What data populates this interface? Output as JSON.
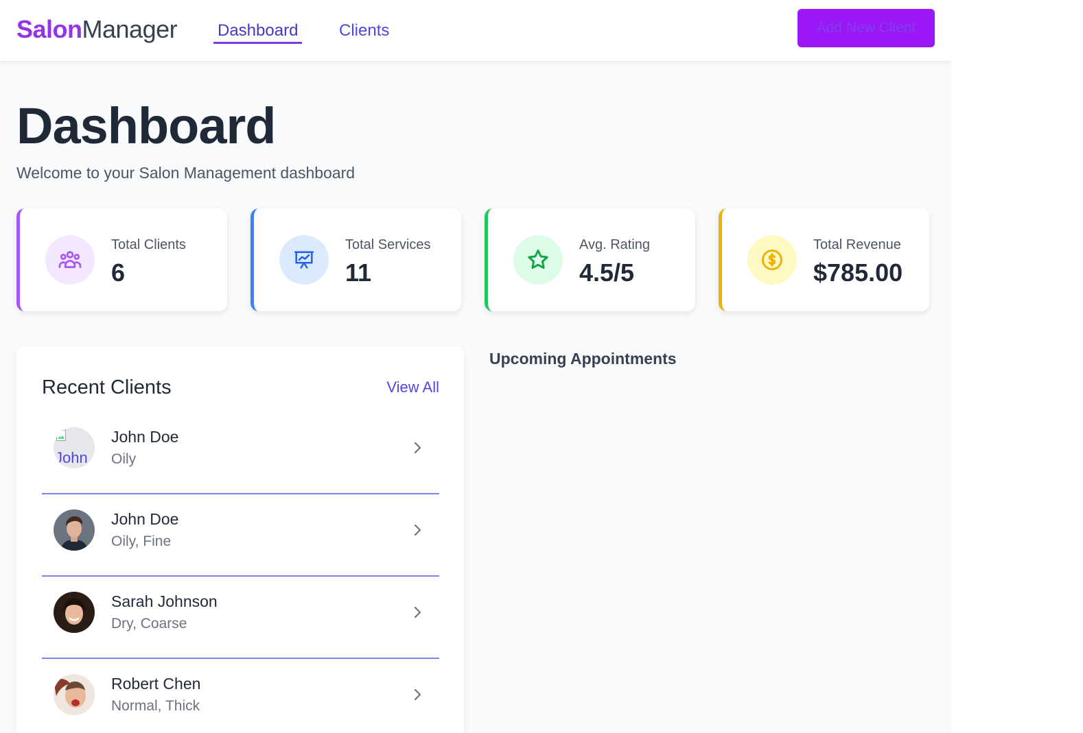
{
  "header": {
    "brand_bold": "Salon",
    "brand_light": "Manager",
    "nav": [
      {
        "label": "Dashboard",
        "active": true
      },
      {
        "label": "Clients",
        "active": false
      }
    ],
    "add_button": "Add New Client"
  },
  "page": {
    "title": "Dashboard",
    "subtitle": "Welcome to your Salon Management dashboard"
  },
  "stats": [
    {
      "label": "Total Clients",
      "value": "6",
      "icon": "users-icon",
      "accent": "#a855f7",
      "icon_bg": "#f3e8ff",
      "icon_color": "#a855f7"
    },
    {
      "label": "Total Services",
      "value": "11",
      "icon": "presentation-chart-icon",
      "accent": "#3b82f6",
      "icon_bg": "#dbeafe",
      "icon_color": "#2563eb"
    },
    {
      "label": "Avg. Rating",
      "value": "4.5/5",
      "icon": "star-icon",
      "accent": "#22c55e",
      "icon_bg": "#dcfce7",
      "icon_color": "#16a34a"
    },
    {
      "label": "Total Revenue",
      "value": "$785.00",
      "icon": "dollar-coin-icon",
      "accent": "#eab308",
      "icon_bg": "#fef9c3",
      "icon_color": "#eab308"
    }
  ],
  "recent_clients": {
    "title": "Recent Clients",
    "view_all": "View All",
    "items": [
      {
        "name": "John Doe",
        "tags": "Oily",
        "avatar_alt": "John",
        "avatar_broken": true
      },
      {
        "name": "John Doe",
        "tags": "Oily, Fine",
        "avatar_broken": false
      },
      {
        "name": "Sarah Johnson",
        "tags": "Dry, Coarse",
        "avatar_broken": false
      },
      {
        "name": "Robert Chen",
        "tags": "Normal, Thick",
        "avatar_broken": false
      }
    ]
  },
  "appointments": {
    "title": "Upcoming Appointments"
  }
}
